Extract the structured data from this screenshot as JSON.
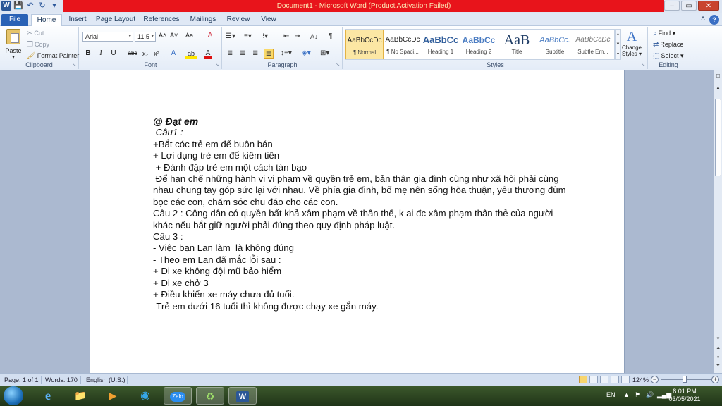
{
  "window": {
    "title": "Document1  -  Microsoft Word (Product Activation Failed)",
    "minimize": "–",
    "maximize": "▭",
    "close": "✕"
  },
  "qat": {
    "word_icon": "W",
    "save_icon": "💾",
    "undo_icon": "↶",
    "redo_icon": "↻",
    "more_icon": "▾"
  },
  "tabs": [
    "File",
    "Home",
    "Insert",
    "Page Layout",
    "References",
    "Mailings",
    "Review",
    "View"
  ],
  "help": "?",
  "ribbon": {
    "clipboard": {
      "label": "Clipboard",
      "paste": "Paste",
      "cut": "Cut",
      "copy": "Copy",
      "format_painter": "Format Painter"
    },
    "font": {
      "label": "Font",
      "font_name": "Arial",
      "font_size": "11.5",
      "grow": "A˄",
      "shrink": "A˅",
      "case": "Aa",
      "clear": "A",
      "bold": "B",
      "italic": "I",
      "underline": "U",
      "strike": "abc",
      "subscript": "x₂",
      "superscript": "x²",
      "effects": "A",
      "highlight": "ab",
      "color": "A"
    },
    "paragraph": {
      "label": "Paragraph",
      "pilcrow": "¶",
      "sort": "A↓"
    },
    "styles": {
      "label": "Styles",
      "items": [
        {
          "sample": "AaBbCcDc",
          "name": "¶ Normal"
        },
        {
          "sample": "AaBbCcDc",
          "name": "¶ No Spaci..."
        },
        {
          "sample": "AaBbCc",
          "name": "Heading 1"
        },
        {
          "sample": "AaBbCc",
          "name": "Heading 2"
        },
        {
          "sample": "AaB",
          "name": "Title"
        },
        {
          "sample": "AaBbCc.",
          "name": "Subtitle"
        },
        {
          "sample": "AaBbCcDc",
          "name": "Subtle Em..."
        }
      ],
      "change_styles_line1": "Change",
      "change_styles_line2": "Styles ▾"
    },
    "editing": {
      "label": "Editing",
      "find": "Find ▾",
      "replace": "Replace",
      "select": "Select ▾"
    }
  },
  "document": {
    "lines": [
      "@ Đạt em",
      " Câu1 :",
      "+Bắt cóc trẻ em để buôn bán",
      "+ Lợi dụng trẻ em để kiếm tiền",
      " + Đánh đập trẻ em một cách tàn bạo",
      " Để hạn chế những hành vi vi phạm về quyền trẻ em, bản thân gia đình cùng như xã hội phải cùng nhau chung tay góp sức lại với nhau. Về phía gia đình, bố mẹ nên sống hòa thuận, yêu thương đùm bọc các con, chăm sóc chu đáo cho các con.",
      "Câu 2 : Công dân có quyền bất khả xâm phạm về thân thể, k ai đc xâm phạm thân thẻ của người khác nếu bắt giữ người phải đúng theo quy định pháp luật.",
      "Câu 3 :",
      "- Việc bạn Lan làm  là không đúng",
      "- Theo em Lan đã mắc lỗi sau :",
      "+ Đi xe không đội mũ bảo hiểm",
      "+ Đi xe chở 3",
      "+ Điều khiển xe máy chưa đủ tuổi.",
      "-Trẻ em dưới 16 tuổi thì không được chạy xe gắn máy."
    ]
  },
  "status": {
    "page": "Page: 1 of 1",
    "words": "Words: 170",
    "language": "English (U.S.)",
    "zoom": "124%",
    "zoom_minus": "−",
    "zoom_plus": "+"
  },
  "taskbar": {
    "apps": [
      "e",
      "📁",
      "▶",
      "◉",
      "Zalo",
      "♻",
      "W"
    ],
    "language": "EN",
    "time": "8:01 PM",
    "date": "03/05/2021"
  }
}
